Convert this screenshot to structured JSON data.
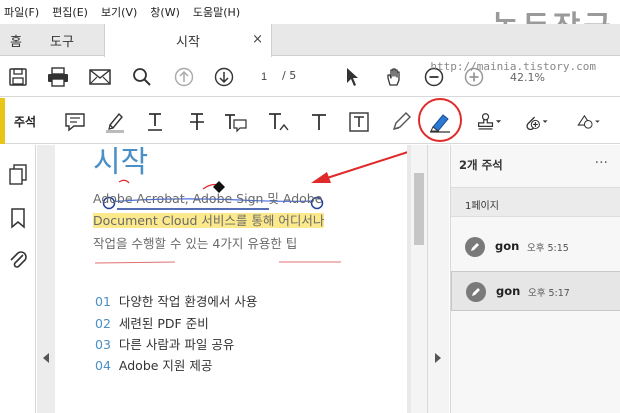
{
  "menubar": {
    "items": [
      "파일(F)",
      "편집(E)",
      "보기(V)",
      "창(W)",
      "도움말(H)"
    ]
  },
  "watermark": {
    "text": "녹두장군",
    "url": "http://mainia.tistory.com"
  },
  "tabs": {
    "home": "홈",
    "tools": "도구",
    "document": "시작",
    "close": "×"
  },
  "toolbar": {
    "page_current": "1",
    "page_total": "/ 5",
    "zoom": "42.1%"
  },
  "annotbar": {
    "label": "주석"
  },
  "document": {
    "heading": "시작",
    "line1": "Adobe Acrobat, Adobe Sign 및 Adobe",
    "line2": "Document Cloud 서비스를 통해 어디서나",
    "line3": "작업을 수행할 수 있는 4가지 유용한 팁",
    "list": [
      {
        "num": "01",
        "text": "다양한 작업 환경에서 사용"
      },
      {
        "num": "02",
        "text": "세련된 PDF 준비"
      },
      {
        "num": "03",
        "text": "다른 사람과 파일 공유"
      },
      {
        "num": "04",
        "text": "Adobe 지원 제공"
      }
    ]
  },
  "panel": {
    "title": "2개 주석",
    "more": "···",
    "section": "1페이지",
    "comments": [
      {
        "author": "gon",
        "time": "오후 5:15"
      },
      {
        "author": "gon",
        "time": "오후 5:17"
      }
    ]
  },
  "colors": {
    "accent": "#e8c517",
    "highlight": "#fce98c",
    "annotation_red": "#e02a2a",
    "heading_blue": "#4a8fc6"
  }
}
